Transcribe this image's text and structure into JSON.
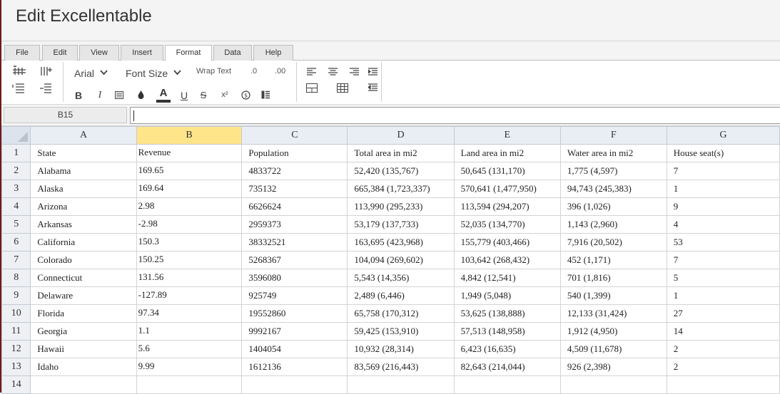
{
  "app": {
    "title": "Edit Excellentable"
  },
  "tabs": [
    {
      "label": "File",
      "active": false
    },
    {
      "label": "Edit",
      "active": false
    },
    {
      "label": "View",
      "active": false
    },
    {
      "label": "Insert",
      "active": false
    },
    {
      "label": "Format",
      "active": true
    },
    {
      "label": "Data",
      "active": false
    },
    {
      "label": "Help",
      "active": false
    }
  ],
  "ribbon": {
    "font_family": "Arial",
    "font_size": "Font Size",
    "wrap_text": "Wrap Text",
    "decrease_decimal": ".0",
    "increase_decimal": ".00",
    "bold": "B",
    "italic": "I",
    "text_color": "A",
    "underline": "U",
    "strikethrough": "S",
    "superscript": "x²"
  },
  "formula_bar": {
    "cell_ref": "B15",
    "value": ""
  },
  "grid": {
    "columns": [
      "A",
      "B",
      "C",
      "D",
      "E",
      "F",
      "G"
    ],
    "selected_column": "B",
    "rows": [
      {
        "n": "1",
        "cells": [
          "State",
          "Revenue",
          "Population",
          "Total area in mi2",
          "Land area in mi2",
          "Water area in mi2",
          "House seat(s)"
        ]
      },
      {
        "n": "2",
        "cells": [
          "Alabama",
          "169.65",
          "4833722",
          "52,420 (135,767)",
          "50,645 (131,170)",
          "1,775 (4,597)",
          "7"
        ]
      },
      {
        "n": "3",
        "cells": [
          "Alaska",
          "169.64",
          "735132",
          "665,384 (1,723,337)",
          "570,641 (1,477,950)",
          "94,743 (245,383)",
          "1"
        ]
      },
      {
        "n": "4",
        "cells": [
          "Arizona",
          "2.98",
          "6626624",
          "113,990 (295,233)",
          "113,594 (294,207)",
          "396 (1,026)",
          "9"
        ]
      },
      {
        "n": "5",
        "cells": [
          "Arkansas",
          "-2.98",
          "2959373",
          "53,179 (137,733)",
          "52,035 (134,770)",
          "1,143 (2,960)",
          "4"
        ]
      },
      {
        "n": "6",
        "cells": [
          "California",
          "150.3",
          "38332521",
          "163,695 (423,968)",
          "155,779 (403,466)",
          "7,916 (20,502)",
          "53"
        ]
      },
      {
        "n": "7",
        "cells": [
          "Colorado",
          "150.25",
          "5268367",
          "104,094 (269,602)",
          "103,642 (268,432)",
          "452 (1,171)",
          "7"
        ]
      },
      {
        "n": "8",
        "cells": [
          "Connecticut",
          "131.56",
          "3596080",
          "5,543 (14,356)",
          "4,842 (12,541)",
          "701 (1,816)",
          "5"
        ]
      },
      {
        "n": "9",
        "cells": [
          "Delaware",
          "-127.89",
          "925749",
          "2,489 (6,446)",
          "1,949 (5,048)",
          "540 (1,399)",
          "1"
        ]
      },
      {
        "n": "10",
        "cells": [
          "Florida",
          "97.34",
          "19552860",
          "65,758 (170,312)",
          "53,625 (138,888)",
          "12,133 (31,424)",
          "27"
        ]
      },
      {
        "n": "11",
        "cells": [
          "Georgia",
          "1.1",
          "9992167",
          "59,425 (153,910)",
          "57,513 (148,958)",
          "1,912 (4,950)",
          "14"
        ]
      },
      {
        "n": "12",
        "cells": [
          "Hawaii",
          "5.6",
          "1404054",
          "10,932 (28,314)",
          "6,423 (16,635)",
          "4,509 (11,678)",
          "2"
        ]
      },
      {
        "n": "13",
        "cells": [
          "Idaho",
          "9.99",
          "1612136",
          "83,569 (216,443)",
          "82,643 (214,044)",
          "926 (2,398)",
          "2"
        ]
      },
      {
        "n": "14",
        "cells": [
          "",
          "",
          "",
          "",
          "",
          "",
          ""
        ]
      }
    ]
  }
}
